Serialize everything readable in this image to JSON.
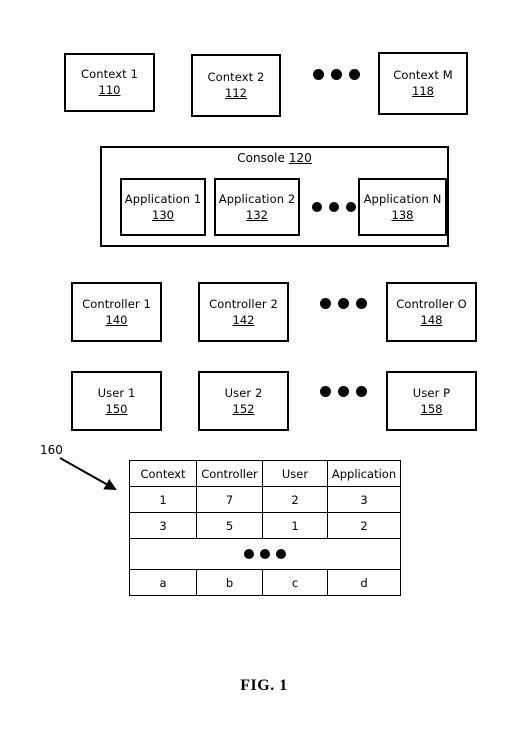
{
  "figure": {
    "caption": "FIG. 1"
  },
  "context_row": {
    "boxes": [
      {
        "label": "Context 1",
        "number": "110"
      },
      {
        "label": "Context 2",
        "number": "112"
      },
      {
        "label": "Context M",
        "number": "118"
      }
    ],
    "ellipsis": "•••"
  },
  "console": {
    "title": "Console",
    "number": "120",
    "applications": [
      {
        "label": "Application 1",
        "number": "130"
      },
      {
        "label": "Application 2",
        "number": "132"
      },
      {
        "label": "Application N",
        "number": "138"
      }
    ],
    "ellipsis": "•••"
  },
  "controller_row": {
    "boxes": [
      {
        "label": "Controller 1",
        "number": "140"
      },
      {
        "label": "Controller 2",
        "number": "142"
      },
      {
        "label": "Controller O",
        "number": "148"
      }
    ],
    "ellipsis": "•••"
  },
  "user_row": {
    "boxes": [
      {
        "label": "User 1",
        "number": "150"
      },
      {
        "label": "User 2",
        "number": "152"
      },
      {
        "label": "User P",
        "number": "158"
      }
    ],
    "ellipsis": "•••"
  },
  "mapping_table": {
    "callout_number": "160",
    "headers": [
      "Context",
      "Controller",
      "User",
      "Application"
    ],
    "rows": [
      [
        "1",
        "7",
        "2",
        "3"
      ],
      [
        "3",
        "5",
        "1",
        "2"
      ]
    ],
    "ellipsis_row": "•••",
    "last_row": [
      "a",
      "b",
      "c",
      "d"
    ]
  }
}
